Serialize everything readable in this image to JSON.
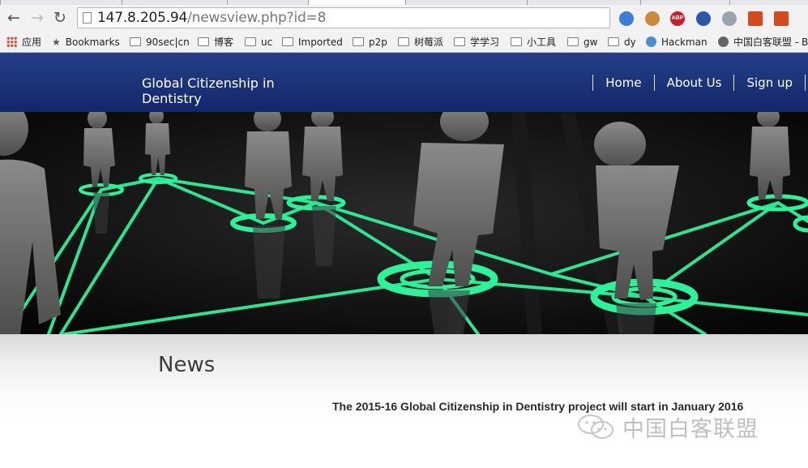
{
  "browser": {
    "url_host": "147.8.205.94",
    "url_path": "/newsview.php?id=8",
    "back_label": "←",
    "forward_label": "→",
    "reload_label": "↻",
    "extensions": [
      {
        "name": "globe",
        "color": "#3b7dd8"
      },
      {
        "name": "cookie",
        "color": "#c98a3a"
      },
      {
        "name": "abp",
        "color": "#c8202a",
        "label": "ABP"
      },
      {
        "name": "ftp",
        "color": "#2d57a8"
      },
      {
        "name": "planet",
        "color": "#9aa3ad"
      },
      {
        "name": "lantern",
        "color": "#d24a1e"
      },
      {
        "name": "lantern2",
        "color": "#d24a1e"
      }
    ]
  },
  "bookmarks": [
    {
      "icon": "apps",
      "label": "应用"
    },
    {
      "icon": "star",
      "label": "Bookmarks"
    },
    {
      "icon": "folder",
      "label": "90sec|cn"
    },
    {
      "icon": "folder",
      "label": "博客"
    },
    {
      "icon": "folder",
      "label": "uc"
    },
    {
      "icon": "folder",
      "label": "Imported"
    },
    {
      "icon": "folder",
      "label": "p2p"
    },
    {
      "icon": "folder",
      "label": "树莓派"
    },
    {
      "icon": "folder",
      "label": "学学习"
    },
    {
      "icon": "folder",
      "label": "小工具"
    },
    {
      "icon": "folder",
      "label": "gw"
    },
    {
      "icon": "folder",
      "label": "dy"
    },
    {
      "icon": "globe",
      "label": "Hackman"
    },
    {
      "icon": "gear",
      "label": "中国白客联盟 - B"
    }
  ],
  "site": {
    "title": "Global Citizenship in Dentistry",
    "nav": [
      "Home",
      "About Us",
      "Sign up"
    ]
  },
  "content": {
    "heading": "News",
    "news_title": "The 2015-16 Global Citizenship in Dentistry project will start in January 2016"
  },
  "watermark": {
    "text": "中国白客联盟"
  },
  "colors": {
    "header_bg": "#1c3277",
    "network_glow": "#2cf29a",
    "figure_gray": "#6e6e6c"
  }
}
